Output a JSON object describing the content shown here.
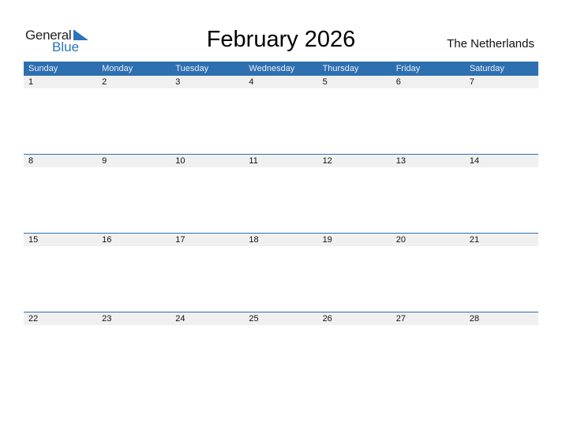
{
  "logo": {
    "general": "General",
    "blue": "Blue"
  },
  "title": "February 2026",
  "country": "The Netherlands",
  "weekdays": [
    "Sunday",
    "Monday",
    "Tuesday",
    "Wednesday",
    "Thursday",
    "Friday",
    "Saturday"
  ],
  "weeks": [
    [
      "1",
      "2",
      "3",
      "4",
      "5",
      "6",
      "7"
    ],
    [
      "8",
      "9",
      "10",
      "11",
      "12",
      "13",
      "14"
    ],
    [
      "15",
      "16",
      "17",
      "18",
      "19",
      "20",
      "21"
    ],
    [
      "22",
      "23",
      "24",
      "25",
      "26",
      "27",
      "28"
    ]
  ],
  "colors": {
    "accent": "#2e6fb0",
    "date_band": "#f0f0f0"
  }
}
